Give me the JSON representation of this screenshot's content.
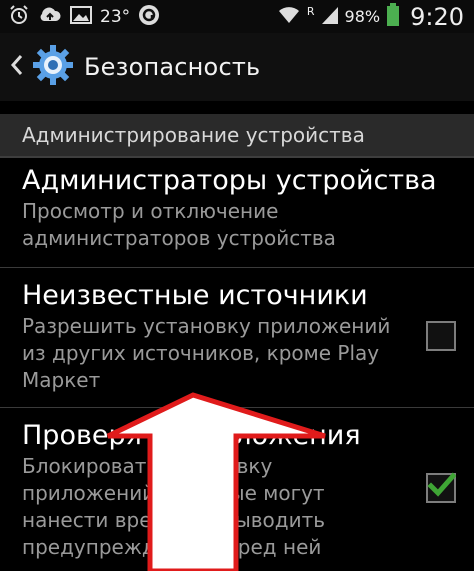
{
  "status_bar": {
    "temperature": "23°",
    "battery_percent": "98%",
    "network_badge": "R",
    "time": "9:20",
    "icons": [
      "alarm-icon",
      "cloud-upload-icon",
      "image-icon",
      "app-circle-icon",
      "wifi-icon",
      "signal-icon",
      "battery-icon"
    ]
  },
  "action_bar": {
    "title": "Безопасность",
    "icons": [
      "chevron-left-icon",
      "gear-icon"
    ]
  },
  "section": {
    "header": "Администрирование устройства"
  },
  "items": [
    {
      "title": "Администраторы устройства",
      "summary_lines": [
        "Просмотр и отключение",
        "администраторов устройства"
      ]
    },
    {
      "title": "Неизвестные источники",
      "summary_lines": [
        "Разрешить установку приложений",
        "из других источников, кроме Play",
        "Маркет"
      ],
      "checked": false
    },
    {
      "title": "Проверять приложения",
      "summary_lines": [
        "Блокировать установку",
        "приложений, которые могут",
        "нанести вред, или выводить",
        "предупреждения перед ней"
      ],
      "checked": true
    }
  ],
  "colors": {
    "check_accent": "#3fa535",
    "overlay_arrow_fill": "#ffffff",
    "overlay_arrow_stroke": "#e01b1b"
  }
}
